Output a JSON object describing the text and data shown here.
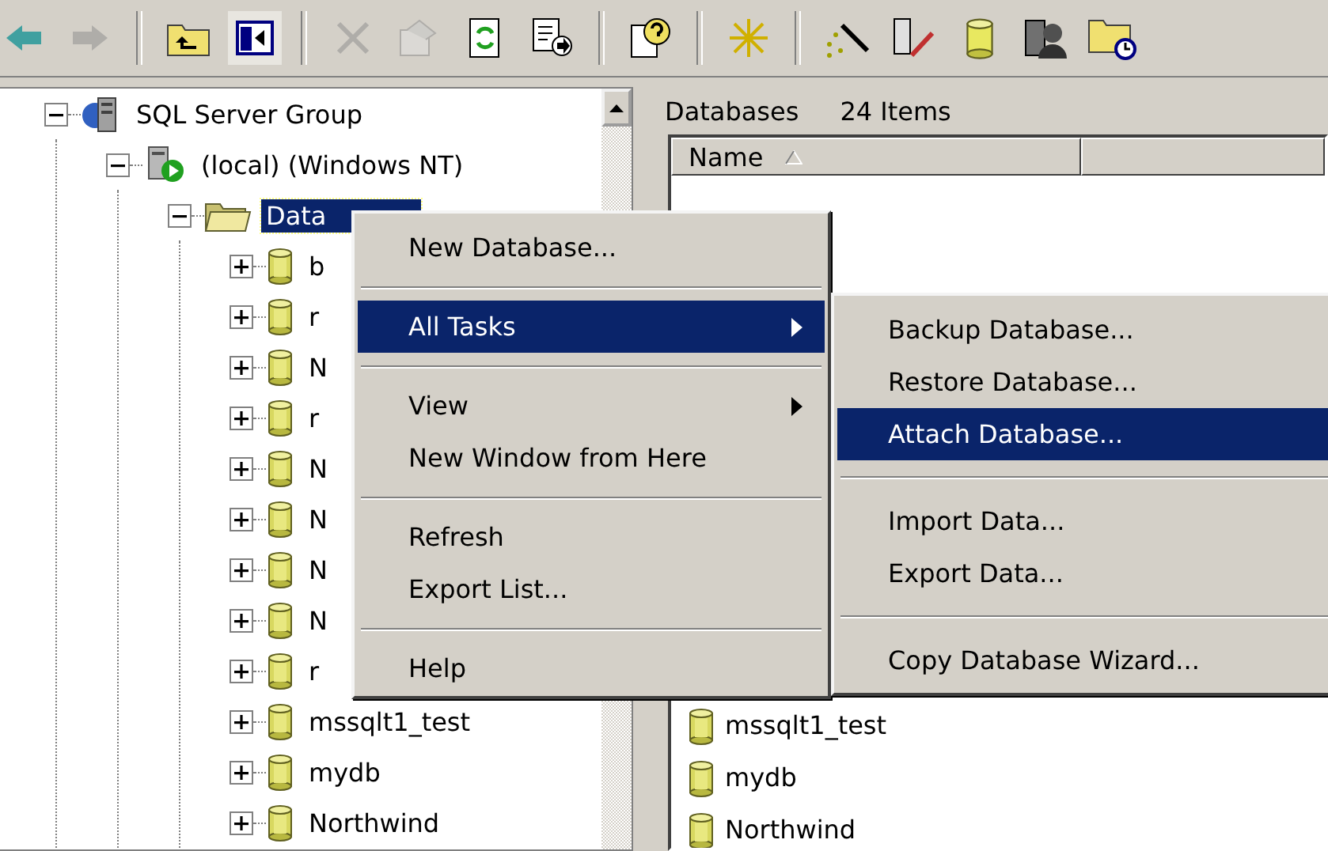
{
  "toolbar": {
    "groups": [
      [
        {
          "kind": "back",
          "disabled": false,
          "pressed": false
        },
        {
          "kind": "forward",
          "disabled": true,
          "pressed": false
        }
      ],
      [
        {
          "kind": "folder-up",
          "disabled": false,
          "pressed": false
        },
        {
          "kind": "panel",
          "disabled": false,
          "pressed": true
        }
      ],
      [
        {
          "kind": "delete",
          "disabled": true,
          "pressed": false
        },
        {
          "kind": "properties",
          "disabled": true,
          "pressed": false
        },
        {
          "kind": "refresh",
          "disabled": false,
          "pressed": false
        },
        {
          "kind": "export",
          "disabled": false,
          "pressed": false
        }
      ],
      [
        {
          "kind": "help",
          "disabled": false,
          "pressed": false
        }
      ],
      [
        {
          "kind": "star",
          "disabled": false,
          "pressed": false
        }
      ],
      [
        {
          "kind": "wand",
          "disabled": false,
          "pressed": false
        },
        {
          "kind": "db-edit",
          "disabled": false,
          "pressed": false
        },
        {
          "kind": "database",
          "disabled": false,
          "pressed": false
        },
        {
          "kind": "user",
          "disabled": false,
          "pressed": false
        },
        {
          "kind": "folder-clock",
          "disabled": false,
          "pressed": false
        }
      ]
    ]
  },
  "tree": [
    {
      "label": "SQL Server Group",
      "kind": "server-group",
      "expanded": true,
      "selected": false,
      "children": [
        {
          "label": "(local) (Windows NT)",
          "kind": "server",
          "expanded": true,
          "selected": false,
          "children": [
            {
              "label": "Data",
              "kind": "folder",
              "expanded": true,
              "selected": true,
              "children": [
                {
                  "label": "b",
                  "kind": "database",
                  "expanded": false,
                  "selected": false
                },
                {
                  "label": "r",
                  "kind": "database",
                  "expanded": false,
                  "selected": false
                },
                {
                  "label": "N",
                  "kind": "database",
                  "expanded": false,
                  "selected": false
                },
                {
                  "label": "r",
                  "kind": "database",
                  "expanded": false,
                  "selected": false
                },
                {
                  "label": "N",
                  "kind": "database",
                  "expanded": false,
                  "selected": false
                },
                {
                  "label": "N",
                  "kind": "database",
                  "expanded": false,
                  "selected": false
                },
                {
                  "label": "N",
                  "kind": "database",
                  "expanded": false,
                  "selected": false
                },
                {
                  "label": "N",
                  "kind": "database",
                  "expanded": false,
                  "selected": false
                },
                {
                  "label": "r",
                  "kind": "database",
                  "expanded": false,
                  "selected": false
                },
                {
                  "label": "mssqlt1_test",
                  "kind": "database",
                  "expanded": false,
                  "selected": false
                },
                {
                  "label": "mydb",
                  "kind": "database",
                  "expanded": false,
                  "selected": false
                },
                {
                  "label": "Northwind",
                  "kind": "database",
                  "expanded": false,
                  "selected": false
                }
              ]
            }
          ]
        }
      ]
    }
  ],
  "details": {
    "title": "Databases",
    "count": "24 Items",
    "columns": [
      {
        "label": "Name",
        "sorted": true
      }
    ],
    "rows": [
      {
        "name": "mssqlt1_test"
      },
      {
        "name": "mydb"
      },
      {
        "name": "Northwind"
      }
    ]
  },
  "context_menu": {
    "items": [
      {
        "kind": "item",
        "label": "New Database...",
        "selected": false,
        "has_submenu": false
      },
      {
        "kind": "separator"
      },
      {
        "kind": "item",
        "label": "All Tasks",
        "selected": true,
        "has_submenu": true
      },
      {
        "kind": "separator"
      },
      {
        "kind": "item",
        "label": "View",
        "selected": false,
        "has_submenu": true
      },
      {
        "kind": "item",
        "label": "New Window from Here",
        "selected": false,
        "has_submenu": false
      },
      {
        "kind": "separator"
      },
      {
        "kind": "item",
        "label": "Refresh",
        "selected": false,
        "has_submenu": false
      },
      {
        "kind": "item",
        "label": "Export List...",
        "selected": false,
        "has_submenu": false
      },
      {
        "kind": "separator"
      },
      {
        "kind": "item",
        "label": "Help",
        "selected": false,
        "has_submenu": false
      }
    ]
  },
  "submenu": {
    "items": [
      {
        "kind": "item",
        "label": "Backup Database...",
        "selected": false,
        "has_submenu": false
      },
      {
        "kind": "item",
        "label": "Restore Database...",
        "selected": false,
        "has_submenu": false
      },
      {
        "kind": "item",
        "label": "Attach Database...",
        "selected": true,
        "has_submenu": false
      },
      {
        "kind": "separator"
      },
      {
        "kind": "item",
        "label": "Import Data...",
        "selected": false,
        "has_submenu": false
      },
      {
        "kind": "item",
        "label": "Export Data...",
        "selected": false,
        "has_submenu": false
      },
      {
        "kind": "separator"
      },
      {
        "kind": "item",
        "label": "Copy Database Wizard...",
        "selected": false,
        "has_submenu": false
      }
    ]
  }
}
